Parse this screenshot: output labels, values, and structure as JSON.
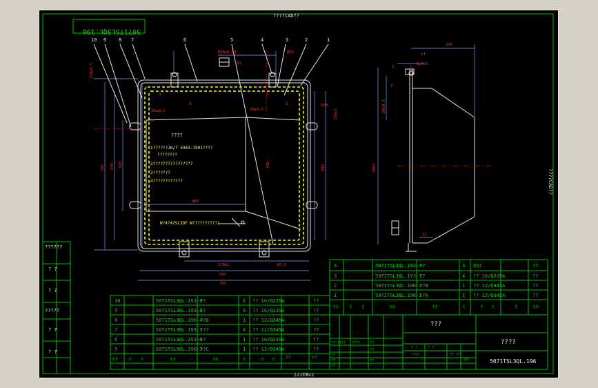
{
  "sheet": {
    "top_label": "????CAD??",
    "bottom_label": "??04???",
    "right_label": "????CAD??",
    "drawing_no_mirrored": "5071TSL3QL.196"
  },
  "notes": {
    "title": "????",
    "lines": [
      "1??????JB/T 5943-1991????",
      "????????",
      "2????????????????",
      "3???????",
      "4????????????"
    ],
    "weld_note": "W?4?4?SL3DF W??????????)"
  },
  "part_numbers": [
    "10",
    "9",
    "8",
    "7",
    "6",
    "5",
    "4",
    "3",
    "2",
    "1"
  ],
  "dimensions": {
    "front": [
      "Ø38±0.03",
      "102",
      "Ø25",
      "210±0.5",
      "3",
      "3",
      "3",
      "3",
      "30±0.5",
      "30±0.5",
      "765",
      "695",
      "418",
      "410",
      "400",
      "400",
      "338±1",
      "Ø75",
      "178±1",
      "87.5",
      "695",
      "765"
    ],
    "side": [
      "200",
      "13",
      "5±0.5",
      "2",
      "20±0.3",
      "7",
      "1063",
      "22"
    ]
  },
  "parts_right": {
    "rows": [
      {
        "no": "4",
        "code": "5071TSL3QL.193-4",
        "name": "??",
        "qty": "3",
        "mat": "65?",
        "note": "??"
      },
      {
        "no": "3",
        "code": "5071TSL3QL.193-3",
        "name": "??",
        "qty": "4",
        "mat": "?? 16/Q235A",
        "note": "??"
      },
      {
        "no": "2",
        "code": "5071TSL3QL.196-2",
        "name": "??B",
        "qty": "1",
        "mat": "?? 12/Q345A",
        "note": "??"
      },
      {
        "no": "1",
        "code": "5071TSL3QL.196-1",
        "name": "??A",
        "qty": "1",
        "mat": "?? 12/Q345A",
        "note": "??"
      }
    ],
    "header": [
      "??",
      "?",
      "?",
      "??",
      "??",
      "?",
      "?",
      "?",
      "?",
      "??"
    ]
  },
  "parts_left": {
    "rows": [
      {
        "no": "10",
        "code": "5071TSL3QL.193-9",
        "name": "??",
        "qty": "6",
        "mat": "?? 16/Q235A",
        "note": "??"
      },
      {
        "no": "9",
        "code": "5071TSL3QL.193-8",
        "name": "??",
        "qty": "6",
        "mat": "?? 16/Q235A",
        "note": "??"
      },
      {
        "no": "8",
        "code": "5071TSL3QL.196-4",
        "name": "??D",
        "qty": "1",
        "mat": "?? 12/Q345A",
        "note": "??"
      },
      {
        "no": "7",
        "code": "5071TSL3QL.193.1",
        "name": "???",
        "qty": "4",
        "mat": "?? 12/Q345A",
        "note": "??"
      },
      {
        "no": "6",
        "code": "5071TSL3QL.193-6",
        "name": "??",
        "qty": "1",
        "mat": "?? 16/Q235A",
        "note": "??"
      },
      {
        "no": "5",
        "code": "5071TSL3QL.196-3",
        "name": "??C",
        "qty": "1",
        "mat": "?? 12/Q345A",
        "note": "??"
      }
    ],
    "header": [
      "??",
      "?",
      "?",
      "??",
      "??",
      "?",
      "?",
      "?",
      "??",
      "??"
    ]
  },
  "title_block": {
    "name": "???",
    "code": "????",
    "drawing_no": "5071TSL3QL.196",
    "scale": "15",
    "small": [
      "?? ????",
      "????",
      "??",
      "??",
      "??",
      "??",
      "??",
      "??",
      "? ?",
      "? ?",
      "????",
      "?? ??"
    ]
  },
  "left_margin": [
    "??????",
    "? ?",
    "? ?",
    "?????",
    "? ?",
    "? ?"
  ]
}
